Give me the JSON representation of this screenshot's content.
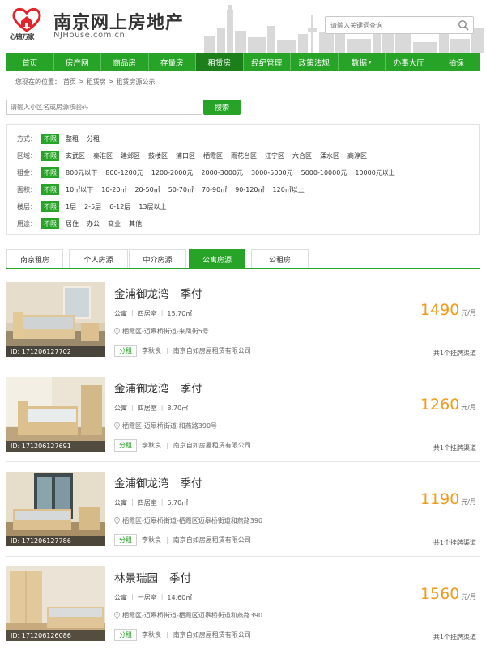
{
  "site": {
    "logo_caption": "心锦万家",
    "title": "南京网上房地产",
    "domain": "NJHouse.com.cn",
    "search_placeholder": "请输入关键词查询"
  },
  "nav": [
    {
      "label": "首页"
    },
    {
      "label": "房产网"
    },
    {
      "label": "商品房"
    },
    {
      "label": "存量房"
    },
    {
      "label": "租赁房",
      "active": true
    },
    {
      "label": "经纪管理"
    },
    {
      "label": "政策法规"
    },
    {
      "label": "数据",
      "dropdown": true
    },
    {
      "label": "办事大厅"
    },
    {
      "label": "拍保"
    }
  ],
  "breadcrumb": {
    "prefix": "您现在的位置：",
    "items": [
      "首页",
      "租赁房",
      "租赁房源公示"
    ]
  },
  "keyword_search": {
    "placeholder": "请输入小区名或房源核验码",
    "button": "搜索"
  },
  "filters": [
    {
      "label": "方式：",
      "options": [
        "不限",
        "整租",
        "分租"
      ]
    },
    {
      "label": "区域：",
      "options": [
        "不限",
        "玄武区",
        "秦淮区",
        "建邺区",
        "鼓楼区",
        "浦口区",
        "栖霞区",
        "雨花台区",
        "江宁区",
        "六合区",
        "溧水区",
        "高淳区"
      ]
    },
    {
      "label": "租金：",
      "options": [
        "不限",
        "800元以下",
        "800-1200元",
        "1200-2000元",
        "2000-3000元",
        "3000-5000元",
        "5000-10000元",
        "10000元以上"
      ]
    },
    {
      "label": "面积：",
      "options": [
        "不限",
        "10㎡以下",
        "10-20㎡",
        "20-50㎡",
        "50-70㎡",
        "70-90㎡",
        "90-120㎡",
        "120㎡以上"
      ]
    },
    {
      "label": "楼层：",
      "options": [
        "不限",
        "1层",
        "2-5层",
        "6-12层",
        "13层以上"
      ]
    },
    {
      "label": "用途：",
      "options": [
        "不限",
        "居住",
        "办公",
        "商业",
        "其他"
      ]
    }
  ],
  "tabs": [
    {
      "label": "南京租房"
    },
    {
      "label": "个人房源"
    },
    {
      "label": "中介房源"
    },
    {
      "label": "公寓房源",
      "active": true
    },
    {
      "label": "公租房"
    }
  ],
  "listings": [
    {
      "id": "ID: 171206127702",
      "name": "金浦御龙湾",
      "pay": "季付",
      "type": "公寓",
      "rooms": "四居室",
      "area": "15.70㎡",
      "address": "栖霞区-迈皋桥街道-来凤街5号",
      "mode": "分租",
      "agent": "李秋良",
      "company": "南京自如房屋租赁有限公司",
      "price": "1490",
      "unit": "元/月",
      "channels": "共1个挂牌渠道"
    },
    {
      "id": "ID: 171206127691",
      "name": "金浦御龙湾",
      "pay": "季付",
      "type": "公寓",
      "rooms": "四居室",
      "area": "8.70㎡",
      "address": "栖霞区-迈皋桥街道-和燕路390号",
      "mode": "分租",
      "agent": "李秋良",
      "company": "南京自如房屋租赁有限公司",
      "price": "1260",
      "unit": "元/月",
      "channels": "共1个挂牌渠道"
    },
    {
      "id": "ID: 171206127786",
      "name": "金浦御龙湾",
      "pay": "季付",
      "type": "公寓",
      "rooms": "四居室",
      "area": "6.70㎡",
      "address": "栖霞区-迈皋桥街道-栖霞区迈皋桥街道和燕路390",
      "mode": "分租",
      "agent": "李秋良",
      "company": "南京自如房屋租赁有限公司",
      "price": "1190",
      "unit": "元/月",
      "channels": "共1个挂牌渠道"
    },
    {
      "id": "ID: 171206126086",
      "name": "林景瑞园",
      "pay": "季付",
      "type": "公寓",
      "rooms": "一居室",
      "area": "14.60㎡",
      "address": "栖霞区-迈皋桥街道-栖霞区迈皋桥街道和燕路390",
      "mode": "分租",
      "agent": "李秋良",
      "company": "南京自如房屋租赁有限公司",
      "price": "1560",
      "unit": "元/月",
      "channels": "共1个挂牌渠道"
    }
  ]
}
